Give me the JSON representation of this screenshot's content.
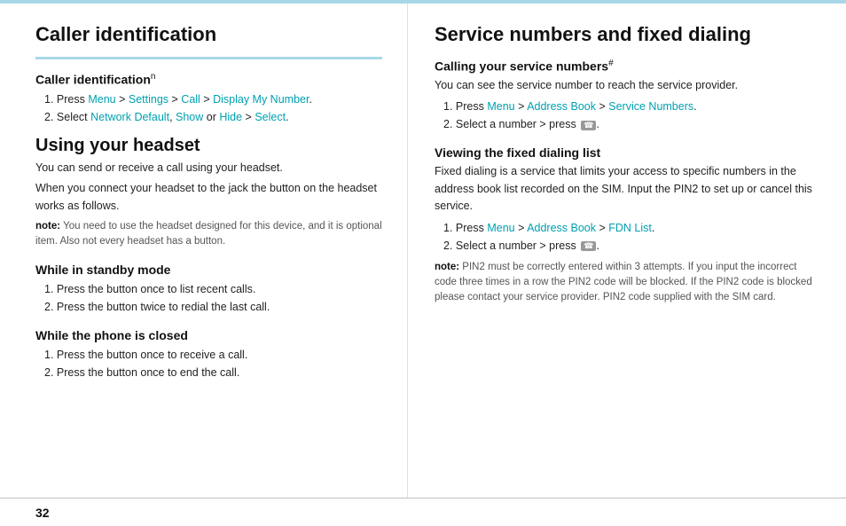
{
  "page": {
    "top_accent_visible": true
  },
  "left_column": {
    "main_title": "Caller identification",
    "subsections": [
      {
        "id": "caller-id",
        "title": "Caller identification",
        "title_sup": "n",
        "steps": [
          {
            "num": "1",
            "parts": [
              {
                "text": "Press ",
                "type": "normal"
              },
              {
                "text": "Menu",
                "type": "cyan"
              },
              {
                "text": " > ",
                "type": "normal"
              },
              {
                "text": "Settings",
                "type": "cyan"
              },
              {
                "text": " > ",
                "type": "normal"
              },
              {
                "text": "Call",
                "type": "cyan"
              },
              {
                "text": " > ",
                "type": "normal"
              },
              {
                "text": "Display My Number",
                "type": "cyan"
              },
              {
                "text": ".",
                "type": "normal"
              }
            ]
          },
          {
            "num": "2",
            "parts": [
              {
                "text": "Select ",
                "type": "normal"
              },
              {
                "text": "Network Default",
                "type": "cyan"
              },
              {
                "text": ", ",
                "type": "normal"
              },
              {
                "text": "Show",
                "type": "cyan"
              },
              {
                "text": " or ",
                "type": "normal"
              },
              {
                "text": "Hide",
                "type": "cyan"
              },
              {
                "text": " > ",
                "type": "normal"
              },
              {
                "text": "Select",
                "type": "cyan"
              },
              {
                "text": ".",
                "type": "normal"
              }
            ]
          }
        ]
      }
    ],
    "using_headset": {
      "title": "Using your headset",
      "intro_lines": [
        "You can send or receive a call using your headset.",
        "When you connect your headset to the jack the button on the headset works as follows."
      ],
      "note_prefix": "note:",
      "note_text": " You need to use the headset designed for this device, and it is optional item. Also not every headset has a button.",
      "subsections": [
        {
          "title": "While in standby mode",
          "steps": [
            {
              "num": "1",
              "text": "Press the button once to list recent calls."
            },
            {
              "num": "2",
              "text": "Press the button twice to redial the last call."
            }
          ]
        },
        {
          "title": "While the phone is closed",
          "steps": [
            {
              "num": "1",
              "text": "Press the button once to receive a call."
            },
            {
              "num": "2",
              "text": "Press the button once to end the call."
            }
          ]
        }
      ]
    }
  },
  "right_column": {
    "main_title": "Service numbers and fixed dialing",
    "subsections": [
      {
        "id": "service-numbers",
        "title": "Calling your service numbers",
        "title_sup": "#",
        "intro": "You can see the service number to reach the service provider.",
        "steps": [
          {
            "num": "1",
            "parts": [
              {
                "text": "Press ",
                "type": "normal"
              },
              {
                "text": "Menu",
                "type": "cyan"
              },
              {
                "text": " > ",
                "type": "normal"
              },
              {
                "text": "Address Book",
                "type": "cyan"
              },
              {
                "text": " > ",
                "type": "normal"
              },
              {
                "text": "Service Numbers",
                "type": "cyan"
              },
              {
                "text": ".",
                "type": "normal"
              }
            ]
          },
          {
            "num": "2",
            "text": "Select a number > press",
            "has_phone_icon": true
          }
        ]
      },
      {
        "id": "fixed-dialing",
        "title": "Viewing the fixed dialing list",
        "intro": "Fixed dialing is a service that limits your access to specific numbers in the address book list recorded on the SIM. Input the PIN2 to set up or cancel this service.",
        "steps": [
          {
            "num": "1",
            "parts": [
              {
                "text": "Press ",
                "type": "normal"
              },
              {
                "text": "Menu",
                "type": "cyan"
              },
              {
                "text": " > ",
                "type": "normal"
              },
              {
                "text": "Address Book",
                "type": "cyan"
              },
              {
                "text": " > ",
                "type": "normal"
              },
              {
                "text": "FDN List",
                "type": "cyan"
              },
              {
                "text": ".",
                "type": "normal"
              }
            ]
          },
          {
            "num": "2",
            "text": "Select a number > press",
            "has_phone_icon": true
          }
        ],
        "note_prefix": "note:",
        "note_text": " PIN2 must be correctly entered within 3 attempts. If you input the incorrect code three times in a row the PIN2 code will be blocked. If the PIN2 code is blocked please contact your service provider. PIN2 code supplied with the SIM card."
      }
    ]
  },
  "bottom": {
    "page_number": "32"
  }
}
